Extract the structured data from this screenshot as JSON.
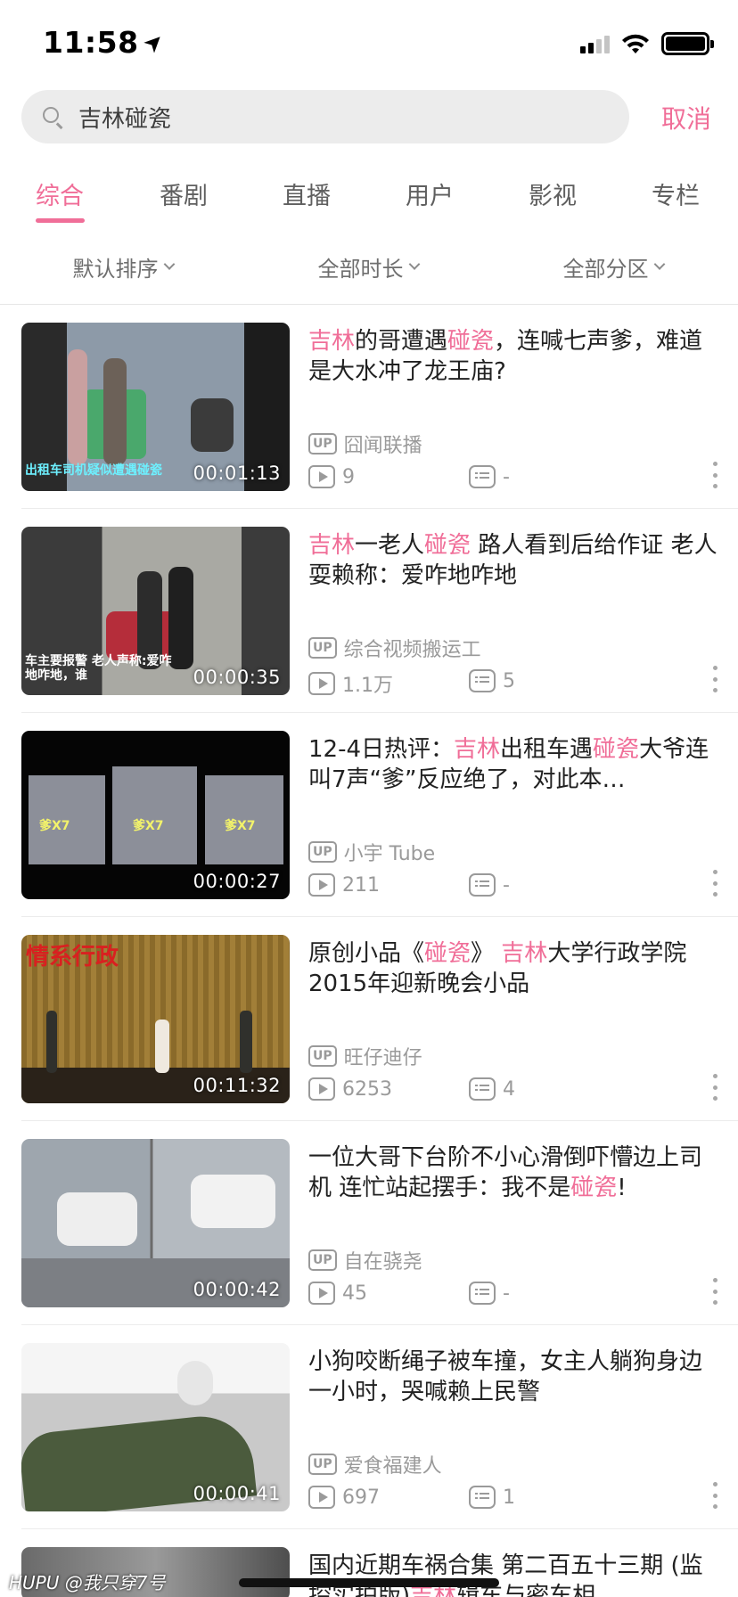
{
  "status_bar": {
    "time": "11:58",
    "time_arrow": "➤"
  },
  "search": {
    "query": "吉林碰瓷",
    "cancel_label": "取消"
  },
  "tabs": [
    {
      "label": "综合",
      "active": true
    },
    {
      "label": "番剧"
    },
    {
      "label": "直播"
    },
    {
      "label": "用户"
    },
    {
      "label": "影视"
    },
    {
      "label": "专栏"
    }
  ],
  "filters": [
    {
      "label": "默认排序"
    },
    {
      "label": "全部时长"
    },
    {
      "label": "全部分区"
    }
  ],
  "colors": {
    "accent": "#f06e98",
    "text": "#212121",
    "muted": "#9a9a9a"
  },
  "videos": [
    {
      "title_segments": [
        [
          "吉林",
          true
        ],
        [
          "的哥遭遇",
          false
        ],
        [
          "碰瓷",
          true
        ],
        [
          "，连喊七声爹，难道是大水冲了龙王庙?",
          false
        ]
      ],
      "duration": "00:01:13",
      "uploader": "囧闻联播",
      "up_badge": "UP",
      "views": "9",
      "danmaku": "-",
      "thumb_caption": "出租车司机疑似遭遇碰瓷"
    },
    {
      "title_segments": [
        [
          "吉林",
          true
        ],
        [
          "一老人",
          false
        ],
        [
          "碰瓷",
          true
        ],
        [
          " 路人看到后给作证 老人耍赖称：爱咋地咋地",
          false
        ]
      ],
      "duration": "00:00:35",
      "uploader": "综合视频搬运工",
      "up_badge": "UP",
      "views": "1.1万",
      "danmaku": "5",
      "thumb_caption": "车主要报警 老人声称:爱咋地咋地，谁"
    },
    {
      "title_segments": [
        [
          "12-4日热评：",
          false
        ],
        [
          "吉林",
          true
        ],
        [
          "出租车遇",
          false
        ],
        [
          "碰瓷",
          true
        ],
        [
          "大爷连叫7声“爹”反应绝了，对此本…",
          false
        ]
      ],
      "duration": "00:00:27",
      "uploader": "小宇 Tube",
      "up_badge": "UP",
      "views": "211",
      "danmaku": "-",
      "thumb_caption": "爹X7"
    },
    {
      "title_segments": [
        [
          "原创小品《",
          false
        ],
        [
          "碰瓷",
          true
        ],
        [
          "》 ",
          false
        ],
        [
          "吉林",
          true
        ],
        [
          "大学行政学院2015年迎新晚会小品",
          false
        ]
      ],
      "duration": "00:11:32",
      "uploader": "旺仔迪仔",
      "up_badge": "UP",
      "views": "6253",
      "danmaku": "4",
      "thumb_caption": ""
    },
    {
      "title_segments": [
        [
          "一位大哥下台阶不小心滑倒吓懵边上司机 连忙站起摆手：我不是",
          false
        ],
        [
          "碰瓷",
          true
        ],
        [
          "!",
          false
        ]
      ],
      "duration": "00:00:42",
      "uploader": "自在骁尧",
      "up_badge": "UP",
      "views": "45",
      "danmaku": "-",
      "thumb_caption": ""
    },
    {
      "title_segments": [
        [
          "小狗咬断绳子被车撞，女主人躺狗身边一小时，哭喊赖上民警",
          false
        ]
      ],
      "duration": "00:00:41",
      "uploader": "爱食福建人",
      "up_badge": "UP",
      "views": "697",
      "danmaku": "1",
      "thumb_caption": ""
    },
    {
      "title_segments": [
        [
          "国内近期车祸合集 第二百五十三期 (监控实拍版)",
          false
        ],
        [
          "吉林",
          true
        ],
        [
          "辑车与密车相…",
          false
        ]
      ],
      "duration": "",
      "uploader": "",
      "up_badge": "",
      "views": "",
      "danmaku": "",
      "thumb_caption": ""
    }
  ],
  "watermark": "HUPU @我只穿7号"
}
